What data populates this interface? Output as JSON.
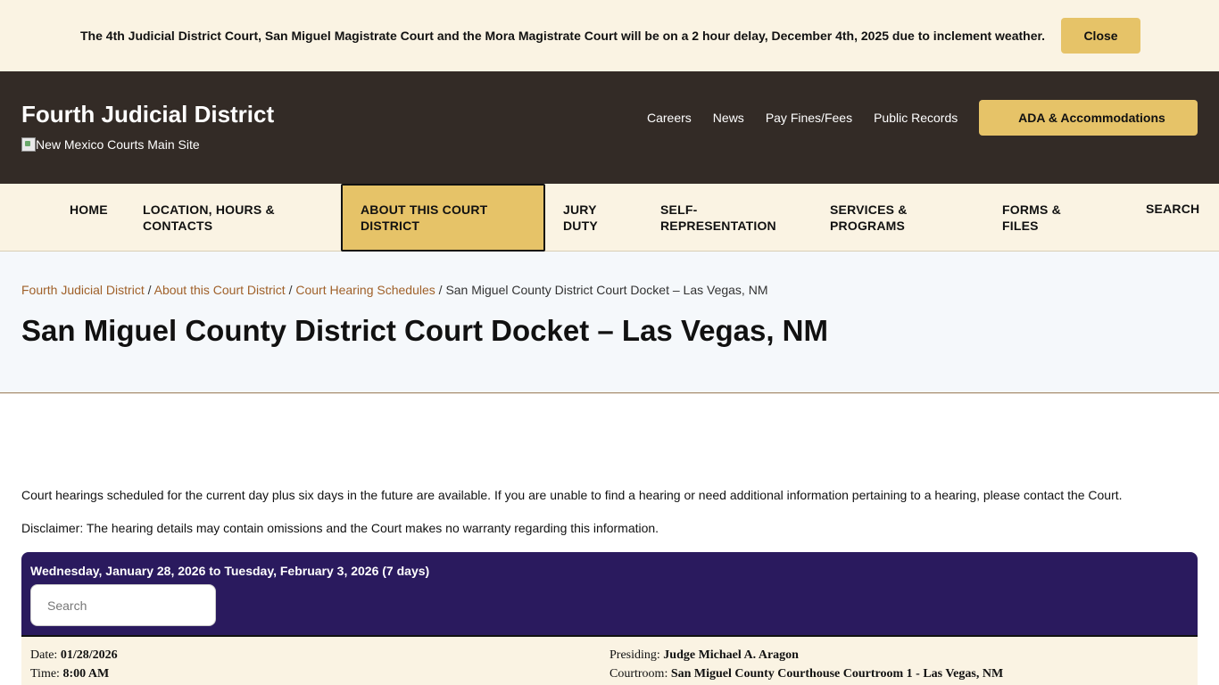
{
  "alert": {
    "text": "The 4th Judicial District Court, San Miguel Magistrate Court and the Mora Magistrate Court will be on a 2 hour delay, December 4th, 2025 due to inclement weather.",
    "close_label": "Close"
  },
  "header": {
    "site_title": "Fourth Judicial District",
    "main_site_alt": "New Mexico Courts Main Site",
    "links": [
      "Careers",
      "News",
      "Pay Fines/Fees",
      "Public Records"
    ],
    "ada_label": "ADA & Accommodations"
  },
  "nav": {
    "items": [
      {
        "label": "HOME"
      },
      {
        "label": "LOCATION, HOURS & CONTACTS"
      },
      {
        "label": "ABOUT THIS COURT DISTRICT",
        "active": true
      },
      {
        "label": "JURY DUTY"
      },
      {
        "label": "SELF-REPRESENTATION"
      },
      {
        "label": "SERVICES & PROGRAMS"
      },
      {
        "label": "FORMS & FILES"
      },
      {
        "label": "SEARCH"
      }
    ]
  },
  "breadcrumb": {
    "items": [
      "Fourth Judicial District",
      "About this Court District",
      "Court Hearing Schedules"
    ],
    "current": "San Miguel County District Court Docket – Las Vegas, NM"
  },
  "page_title": "San Miguel County District Court Docket – Las Vegas, NM",
  "content": {
    "intro": "Court hearings scheduled for the current day plus six days in the future are available. If you are unable to find a hearing or need additional information pertaining to a hearing, please contact the Court.",
    "disclaimer": "Disclaimer:  The hearing details may contain omissions and the Court makes no warranty regarding this information."
  },
  "docket": {
    "range": "Wednesday, January 28, 2026 to Tuesday, February 3, 2026 (7 days)",
    "search_placeholder": "Search",
    "entry": {
      "date_label": "Date:",
      "date": "01/28/2026",
      "time_label": "Time:",
      "time": "8:00 AM",
      "presiding_label": "Presiding:",
      "presiding": "Judge Michael A. Aragon",
      "courtroom_label": "Courtroom:",
      "courtroom": "San Miguel County Courthouse Courtroom 1 - Las Vegas, NM"
    }
  },
  "colors": {
    "alert_bg": "#faf3e3",
    "header_bg": "#332b26",
    "accent_gold": "#e6c368",
    "docket_purple": "#2a1a5e",
    "link_brown": "#a0612a"
  }
}
